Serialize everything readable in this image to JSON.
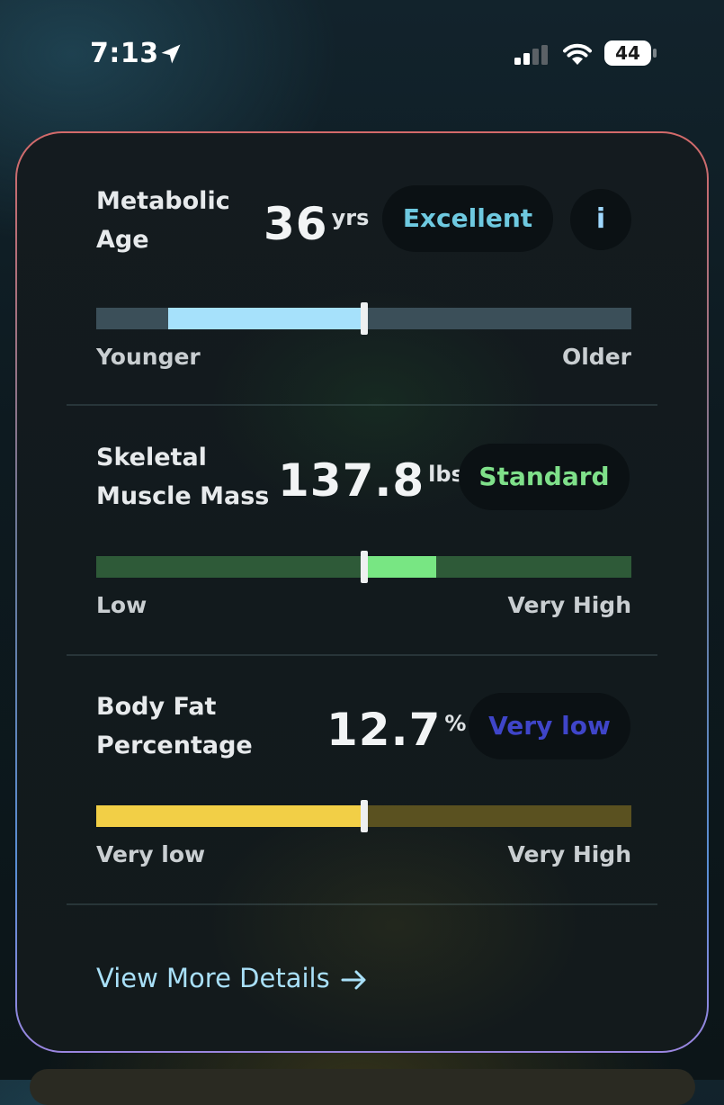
{
  "status_bar": {
    "time": "7:13",
    "battery_level": "44",
    "icons": [
      "location-arrow-icon",
      "cellular-signal-icon",
      "wifi-icon",
      "battery-icon"
    ]
  },
  "metrics": [
    {
      "label": "Metabolic\nAge",
      "value": "36",
      "unit": "yrs",
      "status": "Excellent",
      "status_color": "#6ec9e0",
      "info_button": "i",
      "range_left": "Younger",
      "range_right": "Older",
      "track_color": "#3b4f59",
      "fill_color": "#a6e1fb",
      "fill_from": 0.135,
      "fill_to": 0.5,
      "marker_position": 0.5
    },
    {
      "label": "Skeletal\nMuscle Mass",
      "value": "137.8",
      "unit": "lbs",
      "status": "Standard",
      "status_color": "#7fe08a",
      "range_left": "Low",
      "range_right": "Very High",
      "track_color": "#2e5a38",
      "fill_color": "#78e683",
      "fill_from": 0.5,
      "fill_to": 0.635,
      "marker_position": 0.5
    },
    {
      "label": "Body Fat\nPercentage",
      "value": "12.7",
      "unit": "%",
      "status": "Very low",
      "status_color": "#3f45c9",
      "range_left": "Very low",
      "range_right": "Very High",
      "track_color": "#5a5120",
      "fill_color": "#f2cf46",
      "fill_from": 0.0,
      "fill_to": 0.5,
      "marker_position": 0.5
    }
  ],
  "view_more": {
    "label": "View More Details",
    "icon": "arrow-right-icon"
  }
}
